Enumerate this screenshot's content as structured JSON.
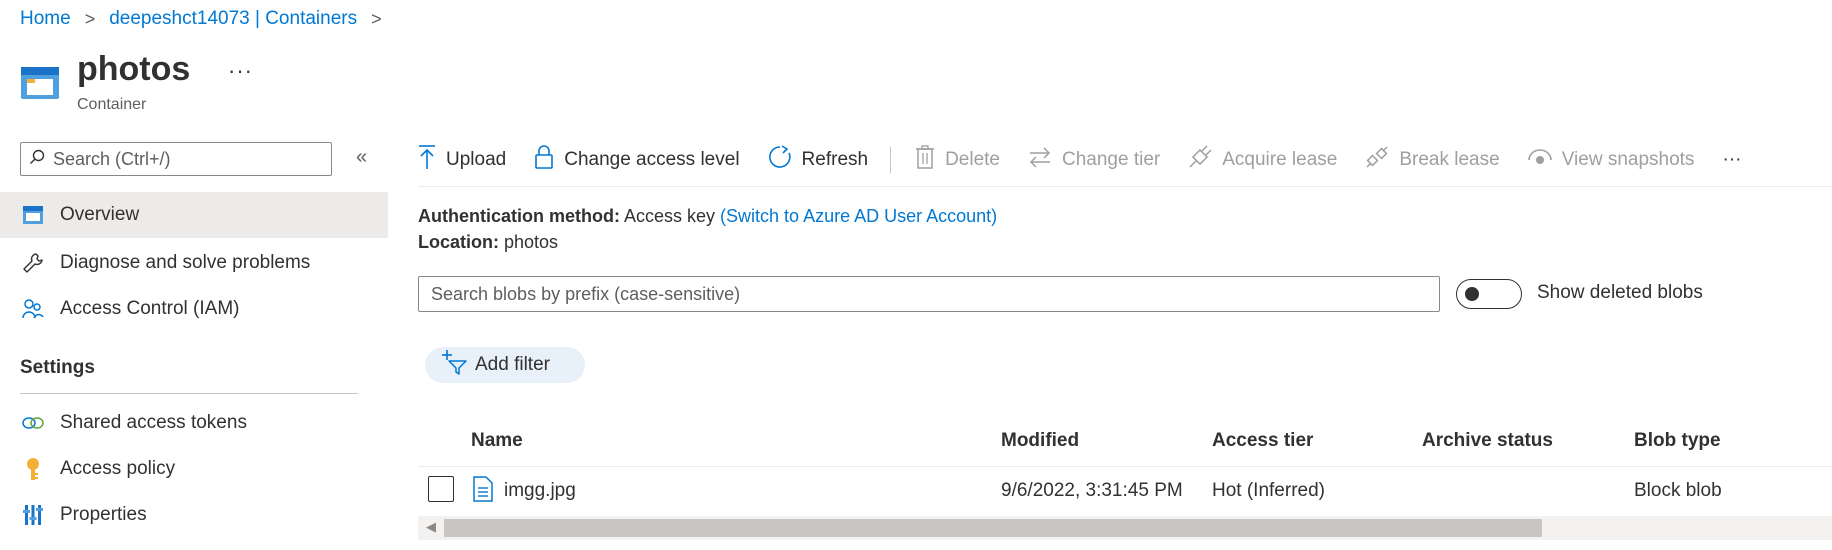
{
  "breadcrumb": {
    "home": "Home",
    "parent": "deepeshct14073 | Containers",
    "separator": ">"
  },
  "header": {
    "title": "photos",
    "subtitle": "Container",
    "more": "···"
  },
  "sidebar": {
    "search_placeholder": "Search (Ctrl+/)",
    "collapse": "«",
    "items": [
      {
        "label": "Overview",
        "icon": "container-icon",
        "active": true
      },
      {
        "label": "Diagnose and solve problems",
        "icon": "wrench-icon"
      },
      {
        "label": "Access Control (IAM)",
        "icon": "people-icon"
      }
    ],
    "settings_heading": "Settings",
    "settings_items": [
      {
        "label": "Shared access tokens",
        "icon": "link-icon"
      },
      {
        "label": "Access policy",
        "icon": "key-icon"
      },
      {
        "label": "Properties",
        "icon": "properties-icon"
      }
    ]
  },
  "toolbar": {
    "upload": "Upload",
    "change_access_level": "Change access level",
    "refresh": "Refresh",
    "delete": "Delete",
    "change_tier": "Change tier",
    "acquire_lease": "Acquire lease",
    "break_lease": "Break lease",
    "view_snapshots": "View snapshots",
    "more": "···"
  },
  "info": {
    "auth_label": "Authentication method:",
    "auth_value": "Access key",
    "auth_link": "(Switch to Azure AD User Account)",
    "location_label": "Location:",
    "location_value": "photos"
  },
  "blob_search": {
    "placeholder": "Search blobs by prefix (case-sensitive)"
  },
  "show_deleted": {
    "label": "Show deleted blobs",
    "on": false
  },
  "filter": {
    "label": "Add filter"
  },
  "table": {
    "columns": [
      "Name",
      "Modified",
      "Access tier",
      "Archive status",
      "Blob type"
    ],
    "rows": [
      {
        "name": "imgg.jpg",
        "modified": "9/6/2022, 3:31:45 PM",
        "access_tier": "Hot (Inferred)",
        "archive_status": "",
        "blob_type": "Block blob"
      }
    ]
  },
  "colors": {
    "accent": "#0078d4",
    "text": "#323130",
    "disabled": "#a19f9d",
    "active_bg": "#edebe9"
  }
}
